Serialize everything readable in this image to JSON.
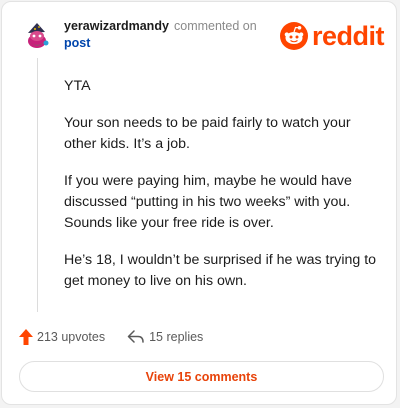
{
  "comment": {
    "username": "yerawizardmandy",
    "commented_on": "commented on",
    "post_link": "post",
    "avatar_icon": "snoo-avatar-icon",
    "body": [
      "YTA",
      "Your son needs to be paid fairly to watch your other kids. It’s a job.",
      "If you were paying him, maybe he would have discussed “putting in his two weeks” with you. Sounds like your free ride is over.",
      "He’s 18, I wouldn’t be surprised if he was trying to get money to live on his own."
    ]
  },
  "brand": {
    "wordmark": "reddit",
    "icon": "reddit-alien-icon",
    "color": "#ff4500"
  },
  "actions": {
    "upvotes": "213 upvotes",
    "upvote_icon": "upvote-arrow-icon",
    "replies": "15 replies",
    "reply_icon": "reply-arrow-icon"
  },
  "view_comments_label": "View 15 comments",
  "colors": {
    "accent": "#e8430a",
    "link": "#0045ac"
  }
}
